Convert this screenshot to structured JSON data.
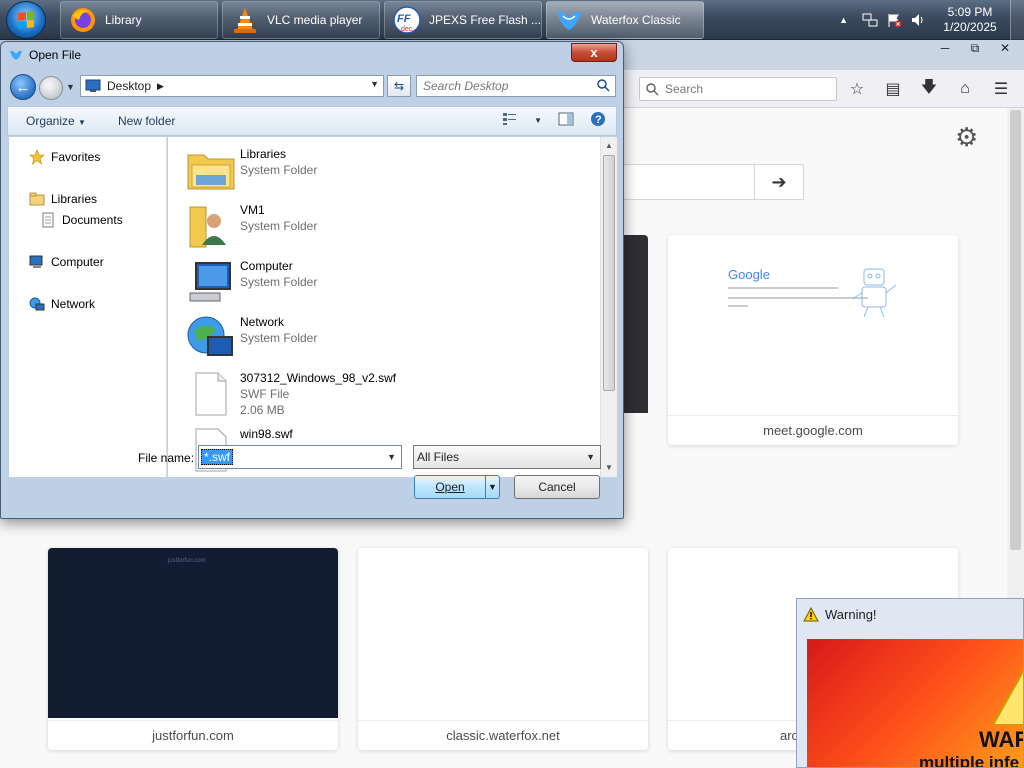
{
  "taskbar": {
    "buttons": [
      {
        "label": "Library",
        "icon": "firefox-icon"
      },
      {
        "label": "VLC media player",
        "icon": "vlc-cone-icon"
      },
      {
        "label": "JPEXS Free Flash ...",
        "icon": "ffdec-icon"
      },
      {
        "label": "Waterfox Classic",
        "icon": "waterfox-icon"
      }
    ],
    "clock": {
      "time": "5:09 PM",
      "date": "1/20/2025"
    }
  },
  "browser": {
    "search_placeholder": "Search",
    "tiles": [
      {
        "label": "meet.google.com"
      },
      {
        "label": "justforfun.com"
      },
      {
        "label": "classic.waterfox.net"
      },
      {
        "label": "arc"
      }
    ],
    "google_thumb_text": "Google",
    "justforfun_thumb_text": "justforfun.com"
  },
  "warning": {
    "title": "Warning!",
    "big_text": "WAR",
    "small_text": "multiple infe"
  },
  "dialog": {
    "title": "Open File",
    "close_label": "x",
    "address": "Desktop",
    "search_placeholder": "Search Desktop",
    "organize_label": "Organize",
    "new_folder_label": "New folder",
    "nav": {
      "favorites": "Favorites",
      "libraries": "Libraries",
      "documents": "Documents",
      "computer": "Computer",
      "network": "Network"
    },
    "files": [
      {
        "name": "Libraries",
        "type": "System Folder"
      },
      {
        "name": "VM1",
        "type": "System Folder"
      },
      {
        "name": "Computer",
        "type": "System Folder"
      },
      {
        "name": "Network",
        "type": "System Folder"
      },
      {
        "name": "307312_Windows_98_v2.swf",
        "type": "SWF File",
        "size": "2.06 MB"
      },
      {
        "name": "win98.swf"
      }
    ],
    "filename_label": "File name:",
    "filename_value": "*.swf",
    "filetype_value": "All Files",
    "open_label": "Open",
    "cancel_label": "Cancel"
  },
  "colors": {
    "taskbar": "#3b4a5e",
    "dialog_frame": "#bdd0e6",
    "selection": "#3399ff",
    "open_button": "#bee6fd"
  }
}
